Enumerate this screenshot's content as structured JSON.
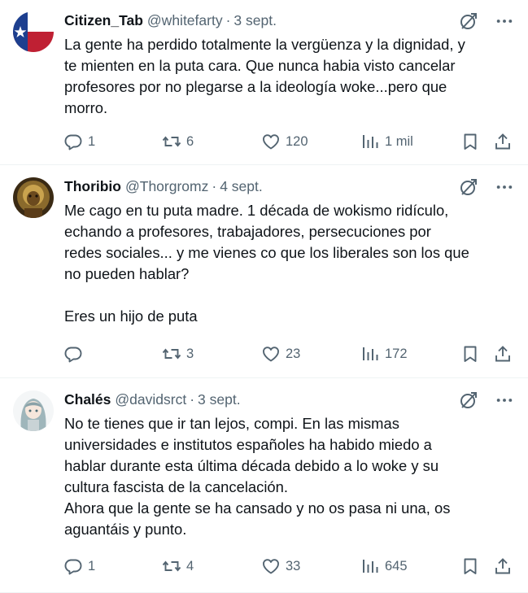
{
  "tweets": [
    {
      "name": "Citizen_Tab",
      "handle": "@whitefarty",
      "dot": "·",
      "date": "3 sept.",
      "avatar_icon": "texas-flag-avatar",
      "lines": [
        "La gente ha perdido totalmente la vergüenza y la dignidad, y",
        "te mienten en la puta cara. Que nunca habia visto cancelar",
        "profesores por no plegarse a la ideología woke...pero que",
        "morro."
      ],
      "replies": "1",
      "retweets": "6",
      "likes": "120",
      "views": "1 mil"
    },
    {
      "name": "Thoribio",
      "handle": "@Thorgromz",
      "dot": "·",
      "date": "4 sept.",
      "avatar_icon": "knight-avatar",
      "lines": [
        "Me cago en tu puta madre. 1 década de wokismo ridículo,",
        "echando a profesores, trabajadores, persecuciones por",
        "redes sociales... y me vienes co que los liberales son los que",
        "no pueden hablar?",
        "",
        "Eres un hijo de puta"
      ],
      "replies": "",
      "retweets": "3",
      "likes": "23",
      "views": "172"
    },
    {
      "name": "Chalés",
      "handle": "@davidsrct",
      "dot": "·",
      "date": "3 sept.",
      "avatar_icon": "anime-girl-avatar",
      "lines": [
        "No te tienes que ir tan lejos, compi. En las mismas",
        "universidades e institutos españoles ha habido miedo a",
        "hablar durante esta última década debido a lo woke y su",
        "cultura fascista de la cancelación.",
        "Ahora que la gente se ha cansado y no os pasa ni una, os",
        "aguantáis y punto."
      ],
      "replies": "1",
      "retweets": "4",
      "likes": "33",
      "views": "645"
    }
  ]
}
